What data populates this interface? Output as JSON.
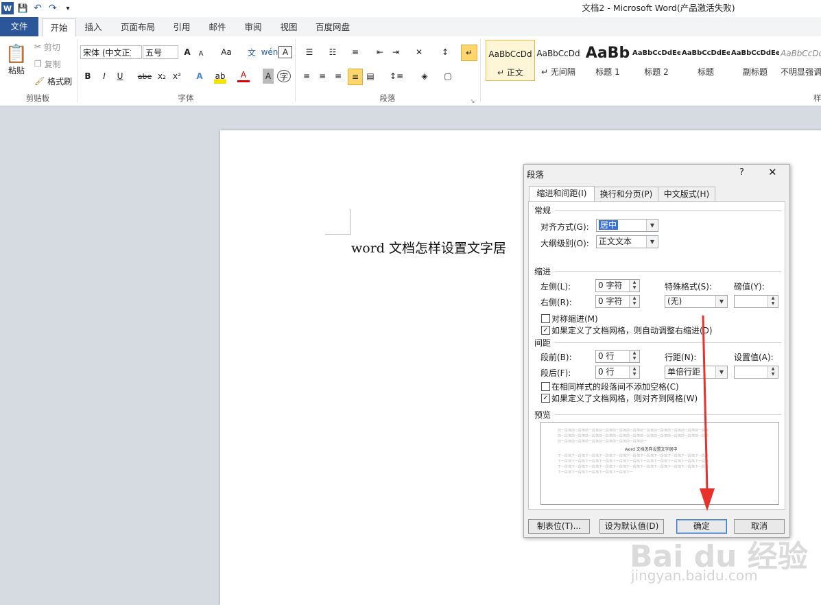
{
  "window": {
    "title": "文档2 - Microsoft Word(产品激活失败)"
  },
  "tabs": [
    "文件",
    "开始",
    "插入",
    "页面布局",
    "引用",
    "邮件",
    "审阅",
    "视图",
    "百度网盘"
  ],
  "clipboard": {
    "paste": "粘贴",
    "cut": "剪切",
    "copy": "复制",
    "format_painter": "格式刷",
    "group": "剪贴板"
  },
  "font": {
    "name": "宋体 (中文正文)",
    "size": "五号",
    "group": "字体",
    "bold": "B",
    "italic": "I",
    "underline": "U",
    "strike": "abe",
    "sub": "x₂",
    "sup": "x²",
    "grow": "A",
    "shrink": "A",
    "case": "Aa",
    "clear": "A"
  },
  "paragraph": {
    "group": "段落"
  },
  "styles": [
    {
      "preview": "AaBbCcDd",
      "name": "正文",
      "marker": "↵ "
    },
    {
      "preview": "AaBbCcDd",
      "name": "无间隔",
      "marker": "↵ "
    },
    {
      "preview": "AaBb",
      "name": "标题 1",
      "marker": ""
    },
    {
      "preview": "AaBbCcDdEe",
      "name": "标题 2",
      "marker": ""
    },
    {
      "preview": "AaBbCcDdEe",
      "name": "标题",
      "marker": ""
    },
    {
      "preview": "AaBbCcDdEe",
      "name": "副标题",
      "marker": ""
    },
    {
      "preview": "AaBbCcDdEe",
      "name": "不明显强调",
      "marker": ""
    }
  ],
  "styles_group_partial": "样",
  "document": {
    "text": "word 文档怎样设置文字居"
  },
  "dialog": {
    "title": "段落",
    "help": "?",
    "close": "✕",
    "tabs": [
      "缩进和间距(I)",
      "换行和分页(P)",
      "中文版式(H)"
    ],
    "general": {
      "heading": "常规",
      "alignment_label": "对齐方式(G):",
      "alignment_value": "居中",
      "outline_label": "大纲级别(O):",
      "outline_value": "正文文本"
    },
    "indent": {
      "heading": "缩进",
      "left_label": "左侧(L):",
      "left_value": "0 字符",
      "right_label": "右侧(R):",
      "right_value": "0 字符",
      "special_label": "特殊格式(S):",
      "special_value": "(无)",
      "by_label": "磅值(Y):",
      "by_value": "",
      "mirror_label": "对称缩进(M)",
      "mirror_checked": false,
      "auto_right_label": "如果定义了文档网格，则自动调整右缩进(D)",
      "auto_right_checked": true
    },
    "spacing": {
      "heading": "间距",
      "before_label": "段前(B):",
      "before_value": "0 行",
      "after_label": "段后(F):",
      "after_value": "0 行",
      "line_label": "行距(N):",
      "line_value": "单倍行距",
      "at_label": "设置值(A):",
      "at_value": "",
      "no_space_label": "在相同样式的段落间不添加空格(C)",
      "no_space_checked": false,
      "snap_label": "如果定义了文档网格，则对齐到网格(W)",
      "snap_checked": true
    },
    "preview": {
      "heading": "预览",
      "sample": "word 文档怎样设置文字居中",
      "filler_prev": "前一段落前一段落前一段落前一段落前一段落前一段落前一段落前一段落前一段落前一段落前一段落",
      "filler_next": "下一段落下一段落下一段落下一段落下一段落下一段落下一段落下一段落下一段落下一段落下一段落"
    },
    "buttons": {
      "tabs": "制表位(T)...",
      "default": "设为默认值(D)",
      "ok": "确定",
      "cancel": "取消"
    }
  },
  "watermark": {
    "brand": "Bai du 经验",
    "url": "jingyan.baidu.com"
  },
  "colors": {
    "file_tab": "#2b579a",
    "arrow": "#e8312a",
    "selection": "#3874d8"
  }
}
